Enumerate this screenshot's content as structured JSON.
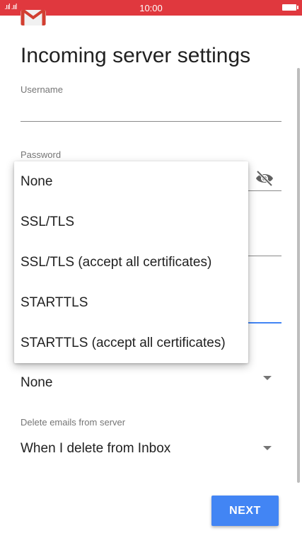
{
  "status_bar": {
    "signal_text": ".ııl .ııl",
    "time": "10:00",
    "background": "#e0383e"
  },
  "header": {
    "logo_icon": "gmail-envelope-icon",
    "title": "Incoming server settings"
  },
  "form": {
    "username_label": "Username",
    "username_value": "",
    "password_label": "Password",
    "password_visibility_icon": "eye-off-icon",
    "security_type_value": "None",
    "delete_label": "Delete emails from server",
    "delete_value": "When I delete from Inbox"
  },
  "security_menu": {
    "options": [
      "None",
      "SSL/TLS",
      "SSL/TLS (accept all certificates)",
      "STARTTLS",
      "STARTTLS (accept all certificates)"
    ]
  },
  "footer": {
    "next_label": "NEXT"
  },
  "colors": {
    "accent": "#4285f4",
    "status_bar": "#e0383e"
  }
}
